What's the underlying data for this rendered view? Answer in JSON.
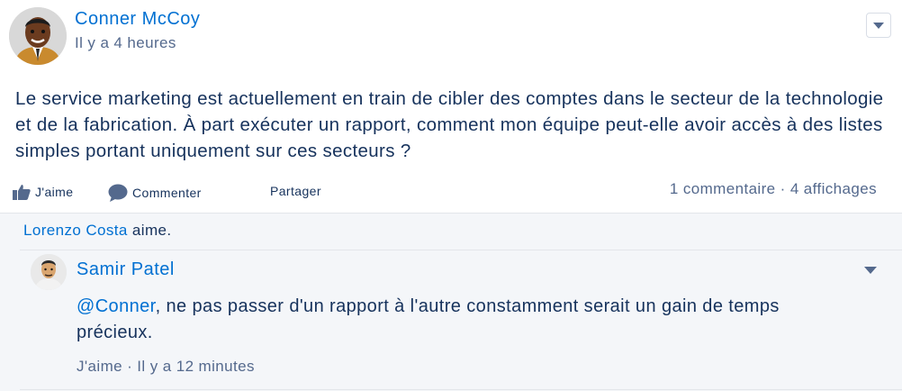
{
  "post": {
    "author": "Conner McCoy",
    "time": "Il y a 4 heures",
    "body": "Le service marketing est actuellement en train de cibler des comptes dans le secteur de la technologie et de la fabrication. À part exécuter un rapport, comment mon équipe peut-elle avoir accès à des listes simples portant uniquement sur ces secteurs ?",
    "menu_icon": "chevron-down-icon"
  },
  "actions": {
    "like": "J'aime",
    "comment": "Commenter",
    "share": "Partager",
    "stats": "1 commentaire · 4 affichages"
  },
  "likes": {
    "name": "Lorenzo Costa",
    "suffix": "aime."
  },
  "comment": {
    "author": "Samir Patel",
    "mention": "@Conner",
    "text": ", ne pas passer d'un rapport à l'autre constamment serait un gain de temps précieux.",
    "footer": "J'aime · Il y a 12 minutes"
  },
  "colors": {
    "link": "#0070d2",
    "text": "#16325c",
    "muted": "#54698d",
    "panel": "#f4f6f9"
  }
}
